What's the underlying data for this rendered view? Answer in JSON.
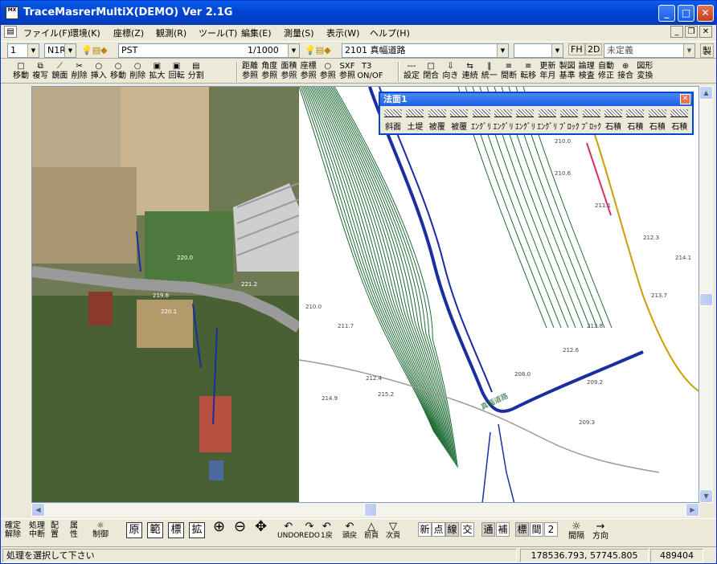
{
  "window": {
    "title": "TraceMasrerMultiX(DEMO) Ver 2.1G",
    "icon_label": "MX"
  },
  "menu": [
    "ファイル(F)",
    "環境(K)",
    "座標(Z)",
    "観測(R)",
    "ツール(T)",
    "編集(E)",
    "測量(S)",
    "表示(W)",
    "ヘルプ(H)"
  ],
  "toolbar1": {
    "scale_combo": "1",
    "layer_combo": "N1R",
    "point_combo": "PST",
    "ratio": "1/1000",
    "road_combo": "2101 真幅道路",
    "fh_label": "FH",
    "dim_label": "2D",
    "undefined_combo": "未定義",
    "right_label": "製"
  },
  "toolbar2": {
    "group1": [
      {
        "icon": "□",
        "label": "移動"
      },
      {
        "icon": "⧉",
        "label": "複写"
      },
      {
        "icon": "⟋",
        "label": "鏡面"
      },
      {
        "icon": "✂",
        "label": "削除"
      },
      {
        "icon": "○",
        "label": "挿入"
      },
      {
        "icon": "○",
        "label": "移動"
      },
      {
        "icon": "○",
        "label": "削除"
      },
      {
        "icon": "▣",
        "label": "拡大"
      },
      {
        "icon": "▣",
        "label": "回転"
      },
      {
        "icon": "▤",
        "label": "分割"
      }
    ],
    "group2": [
      {
        "icon": "距離",
        "label": "参照"
      },
      {
        "icon": "角度",
        "label": "参照"
      },
      {
        "icon": "面積",
        "label": "参照"
      },
      {
        "icon": "座標",
        "label": "参照"
      },
      {
        "icon": "○",
        "label": "参照"
      },
      {
        "icon": "SXF",
        "label": "参照"
      },
      {
        "icon": "T3",
        "label": "ON/OF"
      }
    ],
    "group3": [
      {
        "icon": "---",
        "label": "設定"
      },
      {
        "icon": "□",
        "label": "閉合"
      },
      {
        "icon": "⇩",
        "label": "向き"
      },
      {
        "icon": "⇆",
        "label": "連続"
      },
      {
        "icon": "‖",
        "label": "統一"
      },
      {
        "icon": "≡",
        "label": "間断"
      },
      {
        "icon": "≡",
        "label": "転移"
      },
      {
        "icon": "更新",
        "label": "年月"
      },
      {
        "icon": "製図",
        "label": "基準"
      },
      {
        "icon": "論理",
        "label": "検査"
      },
      {
        "icon": "自動",
        "label": "修正"
      },
      {
        "icon": "⊕",
        "label": "接合"
      },
      {
        "icon": "図形",
        "label": "変換"
      }
    ]
  },
  "panel": {
    "title": "法面1",
    "items": [
      "斜面",
      "土堤",
      "被覆",
      "被覆",
      "ｴﾝｸﾞﾘ",
      "ｴﾝｸﾞﾘ",
      "ｴﾝｸﾞﾘ",
      "ｴﾝｸﾞﾘ",
      "ﾌﾞﾛｯｸ",
      "ﾌﾞﾛｯｸ",
      "石積",
      "石積",
      "石積",
      "石積"
    ]
  },
  "bottom": {
    "left": [
      {
        "l1": "確定",
        "l2": "解除"
      },
      {
        "l1": "処理",
        "l2": "中断"
      },
      {
        "l1": "配",
        "l2": "置"
      },
      {
        "l1": "属",
        "l2": "性"
      },
      {
        "l1": "☼",
        "l2": "制御"
      }
    ],
    "view": [
      "原",
      "範",
      "標",
      "拡"
    ],
    "nav": [
      {
        "icon": "↶",
        "label": "UNDO"
      },
      {
        "icon": "↷",
        "label": "REDO"
      },
      {
        "icon": "↶",
        "label": "1戻"
      },
      {
        "icon": "↶",
        "label": "頭戻"
      },
      {
        "icon": "△",
        "label": "前頁"
      },
      {
        "icon": "▽",
        "label": "次頁"
      }
    ],
    "toggles": [
      "新",
      "点",
      "線",
      "交",
      "通",
      "補",
      "標",
      "間",
      "2"
    ],
    "right": [
      {
        "icon": "☼",
        "label": "間隔"
      },
      {
        "icon": "→",
        "label": "方向"
      }
    ]
  },
  "status": {
    "message": "処理を選択して下さい",
    "coords": "178536.793,  57745.805",
    "value": "489404"
  },
  "map": {
    "spot_heights": [
      "220.0",
      "219.6",
      "220.1",
      "221.2",
      "210.0",
      "210.6",
      "211.1",
      "212.3",
      "213.7",
      "214.1",
      "212.6",
      "214.9",
      "215.2",
      "209.2",
      "209.3",
      "208.0",
      "210.0",
      "211.7",
      "212.4",
      "213.8"
    ],
    "road_label": "真幅道路",
    "colors": {
      "contour": "#1e6b34",
      "road": "#1a2ea0",
      "boundary": "#c8a000",
      "pink": "#d0306a"
    }
  }
}
